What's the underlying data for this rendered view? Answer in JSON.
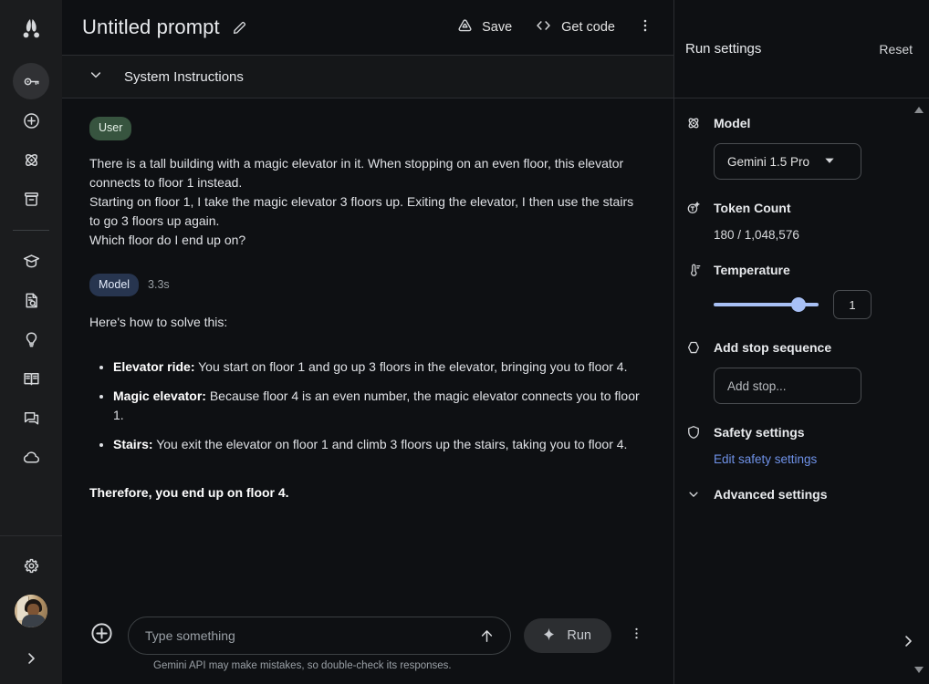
{
  "sidebar": {
    "logo_name": "google-ai-studio-logo",
    "items": [
      {
        "id": "api-key",
        "icon": "key-icon",
        "active": true
      },
      {
        "id": "new-prompt",
        "icon": "plus-circle-icon",
        "active": false
      },
      {
        "id": "tune-model",
        "icon": "atom-icon",
        "active": false
      },
      {
        "id": "library",
        "icon": "archive-icon",
        "active": false
      },
      {
        "id": "learn",
        "icon": "graduation-cap-icon",
        "active": false
      },
      {
        "id": "documentation",
        "icon": "document-search-icon",
        "active": false
      },
      {
        "id": "examples",
        "icon": "lightbulb-icon",
        "active": false
      },
      {
        "id": "cookbook",
        "icon": "book-icon",
        "active": false
      },
      {
        "id": "feedback",
        "icon": "chat-icon",
        "active": false
      },
      {
        "id": "cloud",
        "icon": "cloud-icon",
        "active": false
      }
    ],
    "settings_icon": "gear-icon",
    "avatar_name": "user-avatar",
    "expand_icon": "chevron-right-icon"
  },
  "topbar": {
    "title": "Untitled prompt",
    "edit_icon": "pencil-icon",
    "save_label": "Save",
    "save_icon": "drive-save-icon",
    "get_code_label": "Get code",
    "get_code_icon": "code-brackets-icon",
    "kebab_icon": "more-vertical-icon"
  },
  "system_instructions": {
    "label": "System Instructions",
    "chevron_icon": "chevron-down-icon",
    "expanded": false
  },
  "conversation": {
    "turns": [
      {
        "role_label": "User",
        "role": "user",
        "time": "",
        "lines": [
          "There is a tall building with a magic elevator in it. When stopping on an even floor, this elevator connects to floor 1 instead.",
          "Starting on floor 1, I take the magic elevator 3 floors up. Exiting the elevator, I then use the stairs to go 3 floors up again.",
          "Which floor do I end up on?"
        ]
      },
      {
        "role_label": "Model",
        "role": "model",
        "time": "3.3s",
        "intro": "Here's how to solve this:",
        "bullets": [
          {
            "term": "Elevator ride:",
            "text": " You start on floor 1 and go up 3 floors in the elevator, bringing you to floor 4."
          },
          {
            "term": "Magic elevator:",
            "text": " Because floor 4 is an even number, the magic elevator connects you to floor 1."
          },
          {
            "term": "Stairs:",
            "text": " You exit the elevator on floor 1 and climb 3 floors up the stairs, taking you to floor 4."
          }
        ],
        "conclusion": "Therefore, you end up on floor 4."
      }
    ]
  },
  "composer": {
    "add_icon": "plus-circle-icon",
    "input_value": "",
    "input_placeholder": "Type something",
    "send_icon": "arrow-up-icon",
    "run_label": "Run",
    "run_icon": "sparkle-icon",
    "kebab_icon": "more-vertical-icon",
    "disclaimer": "Gemini API may make mistakes, so double-check its responses."
  },
  "run_settings": {
    "title": "Run settings",
    "reset_label": "Reset",
    "model": {
      "label": "Model",
      "icon": "atom-icon",
      "selected": "Gemini 1.5 Pro",
      "chevron_icon": "chevron-down-icon"
    },
    "token_count": {
      "label": "Token Count",
      "icon": "token-icon",
      "value": "180 / 1,048,576",
      "used": 180,
      "limit": 1048576
    },
    "temperature": {
      "label": "Temperature",
      "icon": "thermometer-icon",
      "value": "1",
      "min": 0,
      "max": 2,
      "percent": 86
    },
    "stop_sequence": {
      "label": "Add stop sequence",
      "icon": "hexagon-stop-icon",
      "value": "",
      "placeholder": "Add stop..."
    },
    "safety": {
      "label": "Safety settings",
      "icon": "shield-icon",
      "link_label": "Edit safety settings"
    },
    "advanced": {
      "label": "Advanced settings",
      "chevron_icon": "chevron-down-icon"
    },
    "scroll_up_icon": "scroll-up-arrow",
    "scroll_down_icon": "scroll-down-arrow",
    "collapse_icon": "chevron-right-icon"
  },
  "colors": {
    "bg": "#0e1013",
    "rail_bg": "#1b1c1e",
    "panel_border": "#2b2d31",
    "accent_blue": "#a8c0f5",
    "link_blue": "#6f92e8",
    "user_badge": "#37543f",
    "model_badge": "#27354f"
  }
}
